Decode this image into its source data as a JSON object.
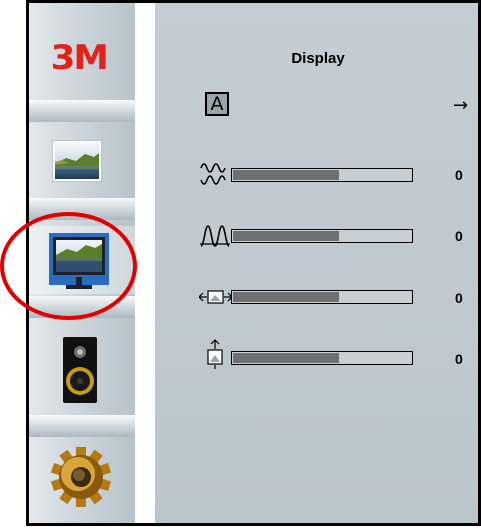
{
  "brand": {
    "logo_text": "3M",
    "logo_color": "#e2231a"
  },
  "sidebar": {
    "items": [
      {
        "name": "picture-menu",
        "icon": "landscape-picture-icon"
      },
      {
        "name": "display-menu",
        "icon": "monitor-icon",
        "selected": true
      },
      {
        "name": "audio-menu",
        "icon": "speaker-icon"
      },
      {
        "name": "settings-menu",
        "icon": "gear-icon"
      }
    ]
  },
  "menu": {
    "title": "Display",
    "auto_adjust": {
      "icon_label": "A",
      "arrow": "→"
    },
    "rows": [
      {
        "name": "clock",
        "icon": "clock-wave-icon",
        "value": "0",
        "level": 0.6
      },
      {
        "name": "phase",
        "icon": "phase-wave-icon",
        "value": "0",
        "level": 0.6
      },
      {
        "name": "horizontal-position",
        "icon": "horizontal-position-icon",
        "value": "0",
        "level": 0.6
      },
      {
        "name": "vertical-position",
        "icon": "vertical-position-icon",
        "value": "0",
        "level": 0.6
      }
    ]
  },
  "colors": {
    "highlight": "#e00000",
    "panel": "#bfc8ce",
    "bar_fill": "#6e6f70"
  }
}
